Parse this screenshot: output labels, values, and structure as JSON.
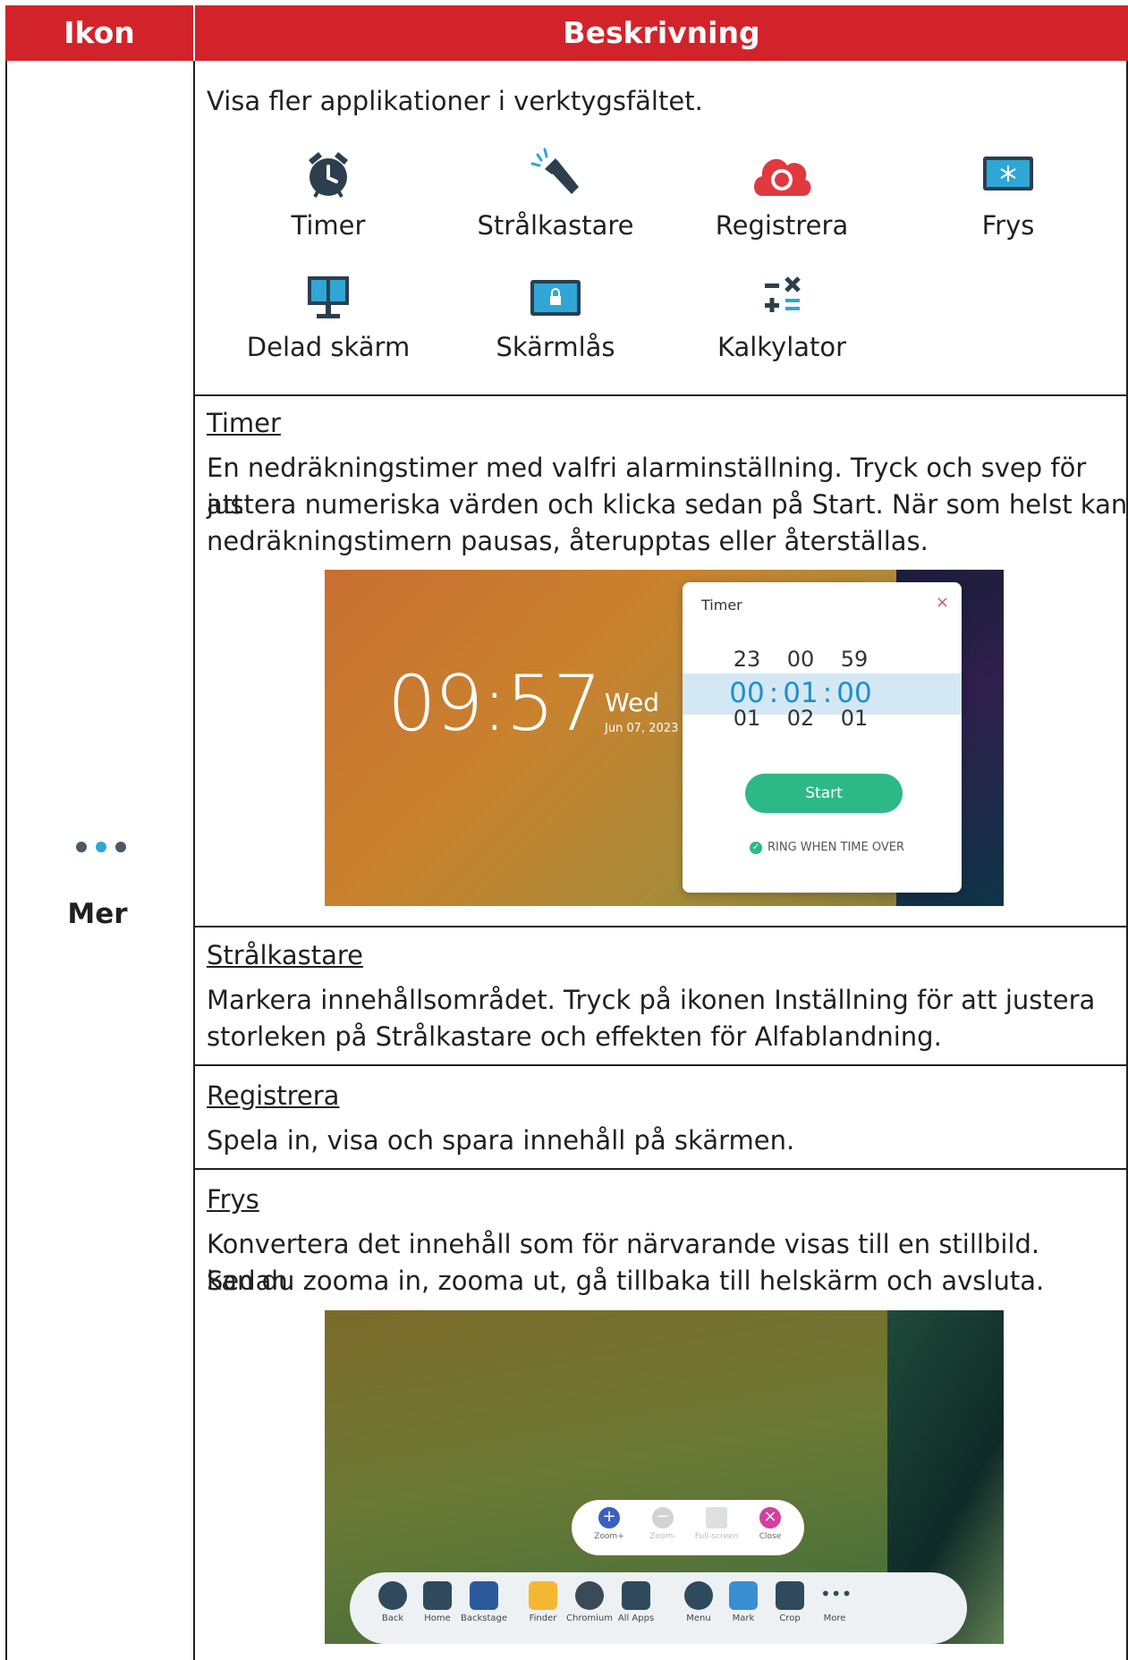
{
  "header": {
    "col_icon": "Ikon",
    "col_desc": "Beskrivning"
  },
  "intro": "Visa fler applikationer i verktygsfältet.",
  "apps": [
    {
      "label": "Timer",
      "icon": "alarm-clock-icon"
    },
    {
      "label": "Strålkastare",
      "icon": "spotlight-icon"
    },
    {
      "label": "Registrera",
      "icon": "record-icon"
    },
    {
      "label": "Frys",
      "icon": "freeze-icon"
    },
    {
      "label": "Delad skärm",
      "icon": "split-screen-icon"
    },
    {
      "label": "Skärmlås",
      "icon": "screen-lock-icon"
    },
    {
      "label": "Kalkylator",
      "icon": "calculator-icon"
    }
  ],
  "mer": {
    "label": "Mer",
    "icon": "more-dots-icon"
  },
  "sections": {
    "timer": {
      "title": "Timer",
      "lines": [
        "En nedräkningstimer med valfri alarminställning. Tryck och svep för att",
        "justera numeriska värden och klicka sedan på Start. När som helst kan",
        "nedräkningstimern pausas, återupptas eller återställas."
      ]
    },
    "spotlight": {
      "title": "Strålkastare",
      "lines": [
        "Markera innehållsområdet. Tryck på ikonen Inställning för att justera",
        "storleken på Strålkastare och effekten för Alfablandning."
      ]
    },
    "record": {
      "title": "Registrera",
      "lines": [
        "Spela in, visa och spara innehåll på skärmen."
      ]
    },
    "freeze": {
      "title": "Frys",
      "lines": [
        "Konvertera det innehåll som för närvarande visas till en stillbild. Sedan",
        "kan du zooma in, zooma ut, gå tillbaka till helskärm och avsluta."
      ]
    }
  },
  "timer_shot": {
    "clock": "09:57",
    "day": "Wed",
    "date": "Jun 07, 2023",
    "panel_title": "Timer",
    "close": "×",
    "row_top": [
      "23",
      "00",
      "59"
    ],
    "row_sel": [
      "00",
      "01",
      "00"
    ],
    "row_bottom": [
      "01",
      "02",
      "01"
    ],
    "sep": ":",
    "start": "Start",
    "ring": "RING WHEN TIME OVER"
  },
  "freeze_shot": {
    "zoom_items": [
      "Zoom+",
      "Zoom-",
      "Full-screen",
      "Close"
    ],
    "toolbar_items": [
      "Back",
      "Home",
      "Backstage",
      "Finder",
      "Chromium",
      "All Apps",
      "Menu",
      "Mark",
      "Crop",
      "More"
    ]
  }
}
